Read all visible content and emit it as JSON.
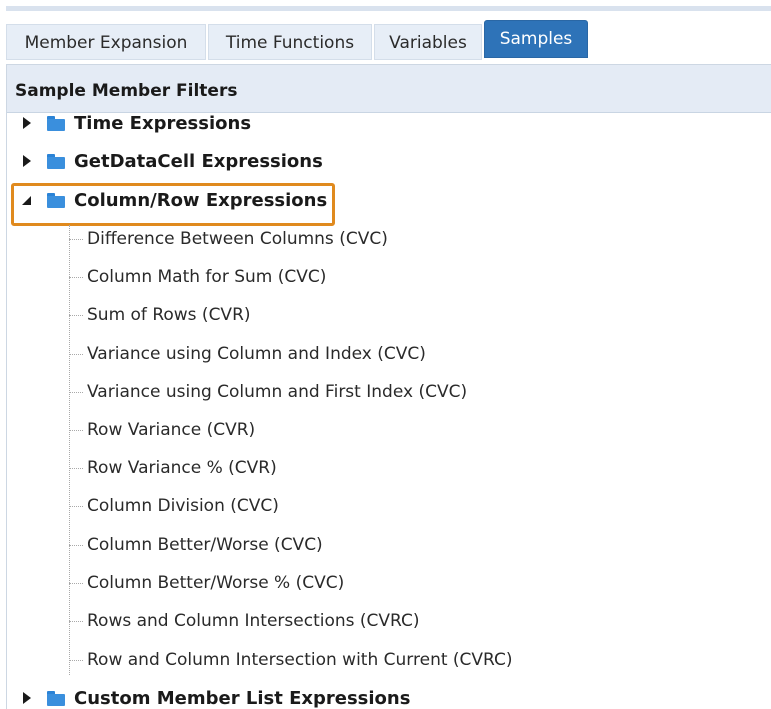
{
  "tabs": [
    {
      "label": "Member Expansion",
      "active": false
    },
    {
      "label": "Time Functions",
      "active": false
    },
    {
      "label": "Variables",
      "active": false
    },
    {
      "label": "Samples",
      "active": true
    }
  ],
  "panel": {
    "title": "Sample Member Filters"
  },
  "tree": {
    "folders": [
      {
        "label": "Time Expressions",
        "expanded": false
      },
      {
        "label": "GetDataCell Expressions",
        "expanded": false
      },
      {
        "label": "Column/Row Expressions",
        "expanded": true,
        "highlighted": true
      },
      {
        "label": "Custom Member List Expressions",
        "expanded": false
      }
    ],
    "column_row_items": [
      "Difference Between Columns (CVC)",
      "Column Math for Sum (CVC)",
      "Sum of Rows (CVR)",
      "Variance using Column and Index (CVC)",
      "Variance using Column and First Index (CVC)",
      "Row Variance (CVR)",
      "Row Variance % (CVR)",
      "Column Division (CVC)",
      "Column Better/Worse (CVC)",
      "Column Better/Worse % (CVC)",
      "Rows and Column Intersections (CVRC)",
      "Row and Column Intersection with Current (CVRC)"
    ]
  },
  "colors": {
    "active_tab": "#2e73b8",
    "highlight": "#e08a1e",
    "folder": "#3a8fdd"
  }
}
